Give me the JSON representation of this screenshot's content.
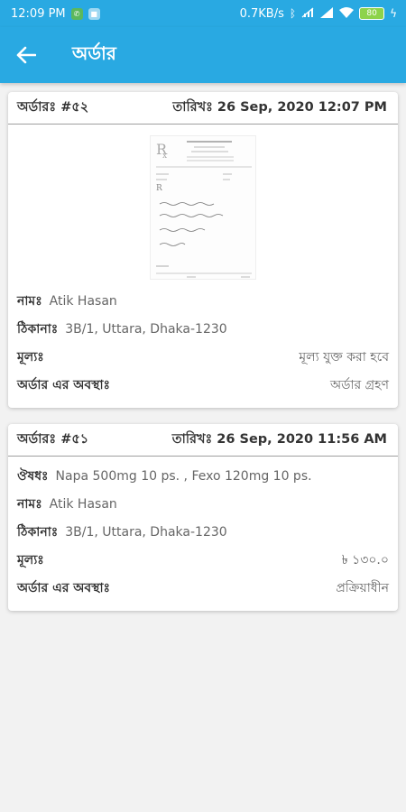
{
  "status_bar": {
    "time": "12:09 PM",
    "net_speed": "0.7KB/s",
    "battery": "80",
    "icons": [
      "whatsapp-icon",
      "app-icon",
      "bluetooth-icon",
      "mute-icon",
      "signal-icon",
      "wifi-icon",
      "battery-icon",
      "charging-icon"
    ]
  },
  "app_bar": {
    "title": "অর্ডার"
  },
  "orders": [
    {
      "order_label": "অর্ডারঃ #৫২",
      "date_label": "তারিখঃ 26 Sep, 2020  12:07 PM",
      "name_label": "নামঃ",
      "name": "Atik Hasan",
      "address_label": "ঠিকানাঃ",
      "address": "3B/1, Uttara, Dhaka-1230",
      "price_label": "মূল্যঃ",
      "price": "মূল্য যুক্ত করা হবে",
      "status_label": "অর্ডার এর অবস্থাঃ",
      "status": "অর্ডার গ্রহণ"
    },
    {
      "order_label": "অর্ডারঃ #৫১",
      "date_label": "তারিখঃ 26 Sep, 2020  11:56 AM",
      "medicine_label": "ঔষধঃ",
      "medicine": "Napa 500mg 10 ps. , Fexo 120mg 10 ps.",
      "name_label": "নামঃ",
      "name": "Atik Hasan",
      "address_label": "ঠিকানাঃ",
      "address": "3B/1, Uttara, Dhaka-1230",
      "price_label": "মূল্যঃ",
      "price": "৳ ১৩০.০",
      "status_label": "অর্ডার এর অবস্থাঃ",
      "status": "প্রক্রিয়াধীন"
    }
  ],
  "colors": {
    "primary": "#29a9e2",
    "background": "#f2f2f2"
  }
}
